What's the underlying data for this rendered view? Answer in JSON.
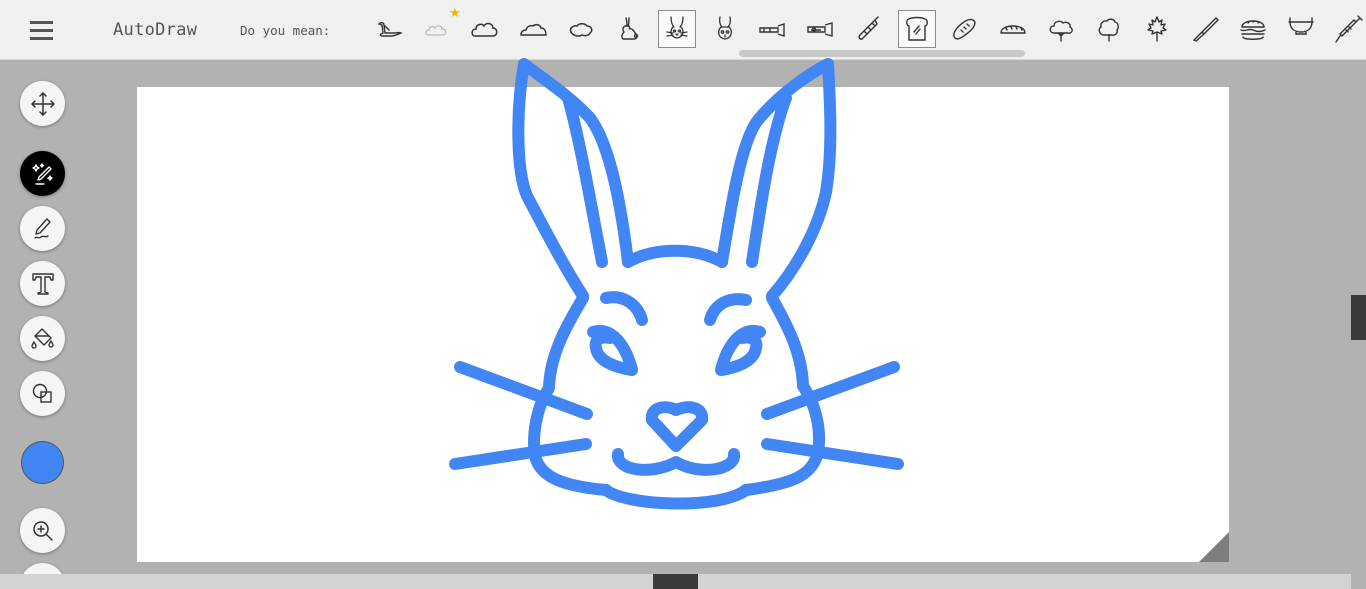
{
  "app": {
    "title": "AutoDraw"
  },
  "suggestions": {
    "label": "Do you mean:",
    "items": [
      {
        "icon": "duck-icon"
      },
      {
        "icon": "cloud-faint-icon"
      },
      {
        "icon": "cloud-icon"
      },
      {
        "icon": "cloud-flat-icon"
      },
      {
        "icon": "cloud-oval-icon"
      },
      {
        "icon": "rabbit-sitting-icon"
      },
      {
        "icon": "rabbit-face-icon",
        "selected": true
      },
      {
        "icon": "rabbit-face-alt-icon"
      },
      {
        "icon": "trombone-icon"
      },
      {
        "icon": "trombone-alt-icon"
      },
      {
        "icon": "saxophone-icon"
      },
      {
        "icon": "toast-icon",
        "selected": true
      },
      {
        "icon": "bread-loaf-icon"
      },
      {
        "icon": "baguette-icon"
      },
      {
        "icon": "tree-round-icon"
      },
      {
        "icon": "tree-bushy-icon"
      },
      {
        "icon": "tree-maple-icon"
      },
      {
        "icon": "knife-icon"
      },
      {
        "icon": "burger-icon"
      },
      {
        "icon": "bowl-icon"
      },
      {
        "icon": "syringe-icon"
      }
    ]
  },
  "tools": [
    {
      "name": "move-tool",
      "icon": "move-arrows-icon"
    },
    {
      "name": "autodraw-tool",
      "icon": "magic-pencil-icon",
      "active": true
    },
    {
      "name": "draw-tool",
      "icon": "pencil-icon"
    },
    {
      "name": "type-tool",
      "icon": "text-t-icon"
    },
    {
      "name": "fill-tool",
      "icon": "paint-bucket-icon"
    },
    {
      "name": "shape-tool",
      "icon": "shapes-icon"
    },
    {
      "name": "zoom-tool",
      "icon": "zoom-in-icon"
    },
    {
      "name": "undo-tool",
      "icon": "undo-icon"
    }
  ],
  "colors": {
    "current": "#4285f4",
    "stroke": "#4285f4",
    "accent_star": "#f5b400"
  }
}
